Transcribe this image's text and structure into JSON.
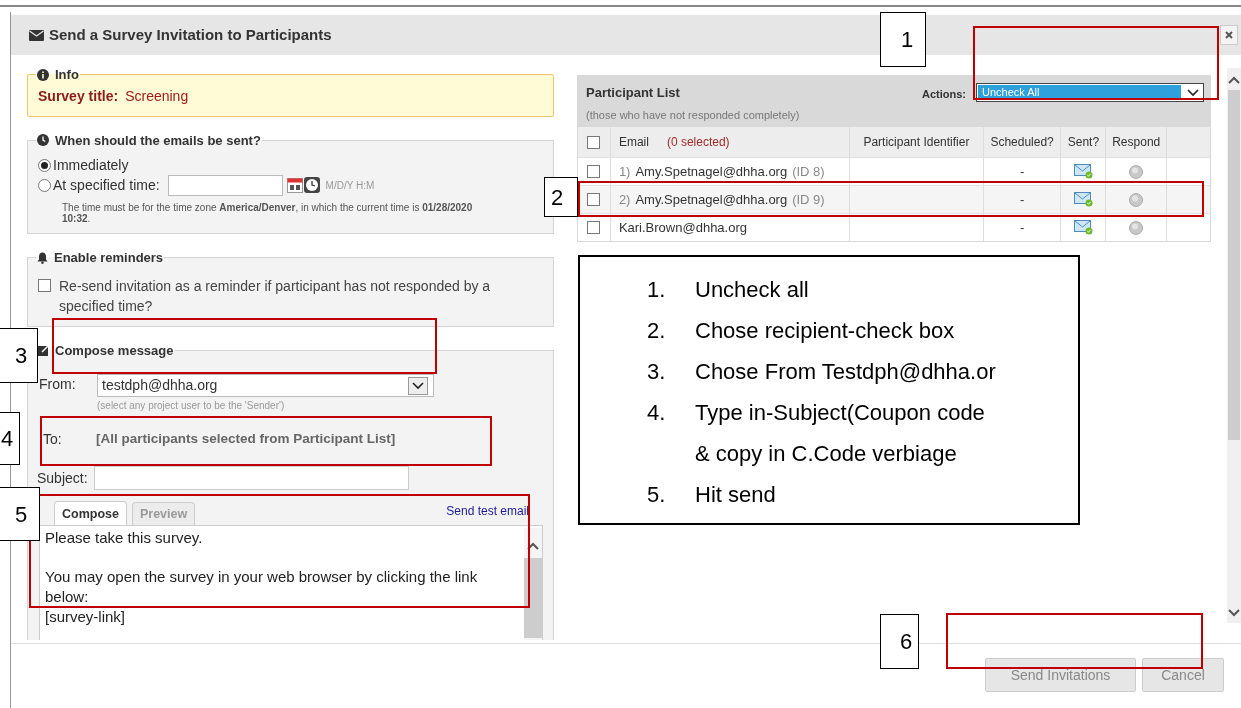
{
  "dialog": {
    "title": "Send a Survey Invitation to Participants"
  },
  "info": {
    "legend": "Info",
    "label": "Survey title:",
    "value": "Screening"
  },
  "schedule": {
    "legend": "When should the emails be sent?",
    "options": [
      {
        "label": "Immediately",
        "selected": true
      },
      {
        "label": "At specified time:",
        "selected": false
      }
    ],
    "format_hint": "M/D/Y H:M",
    "note": "The time must be for the time zone **America/Denver**, in which the current time is **01/28/2020 10:32**."
  },
  "reminders": {
    "legend": "Enable reminders",
    "checkbox": {
      "label": "Re-send invitation as a reminder if participant has not responded by a specified time?",
      "checked": false
    }
  },
  "compose": {
    "legend": "Compose message",
    "from_label": "From:",
    "from_value": "testdph@dhha.org",
    "from_hint": "(select any project user to be the 'Sender')",
    "to_label": "To:",
    "to_value": "[All participants selected from Participant List]",
    "subject_label": "Subject:",
    "tabs": [
      {
        "label": "Compose",
        "selected": true
      },
      {
        "label": "Preview",
        "selected": false
      }
    ],
    "test_email_link": "Send test email",
    "body": [
      {
        "lines": [
          "Please take this survey."
        ]
      },
      {
        "lines": [
          "You may open the survey in your web browser by clicking the link below:",
          "[survey-link]"
        ]
      }
    ]
  },
  "participant_list": {
    "title": "Participant List",
    "subtitle": "(those who have not responded completely)",
    "actions_label": "Actions:",
    "actions_value": "Uncheck All",
    "header_checked": false,
    "selected_count": "(0 selected)",
    "columns": [
      "Email",
      "Participant Identifier",
      "Scheduled?",
      "Sent?",
      "Respond"
    ],
    "rows": [
      {
        "number": "1)",
        "email": "Amy.Spetnagel@dhha.org",
        "id": "(ID 8)",
        "scheduled": "-",
        "checked": false
      },
      {
        "number": "2)",
        "email": "Amy.Spetnagel@dhha.org",
        "id": "(ID 9)",
        "scheduled": "-",
        "checked": false
      },
      {
        "email": "Kari.Brown@dhha.org",
        "scheduled": "-",
        "checked": false
      }
    ]
  },
  "instructions": [
    {
      "number": "1.",
      "lines": [
        "Uncheck all"
      ]
    },
    {
      "number": "2.",
      "lines": [
        "Chose recipient-check box"
      ]
    },
    {
      "number": "3.",
      "lines": [
        "Chose From Testdph@dhha.or"
      ]
    },
    {
      "number": "4.",
      "lines": [
        "Type in-Subject(Coupon code",
        "& copy in C.Code verbiage"
      ]
    },
    {
      "number": "5.",
      "lines": [
        "Hit send"
      ]
    }
  ],
  "callouts": [
    {
      "label": "1"
    },
    {
      "label": "2"
    },
    {
      "label": "3"
    },
    {
      "label": "4"
    },
    {
      "label": "5"
    },
    {
      "label": "6"
    }
  ],
  "footer": {
    "buttons": [
      {
        "label": "Send Invitations",
        "disabled": true
      },
      {
        "label": "Cancel",
        "disabled": true
      }
    ]
  }
}
